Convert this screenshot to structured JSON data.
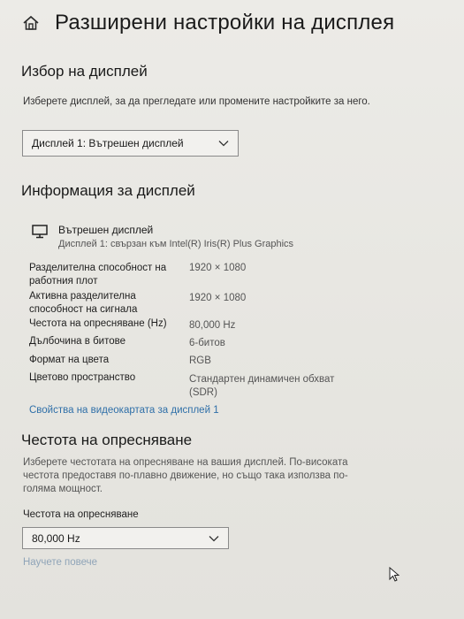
{
  "header": {
    "title": "Разширени настройки на дисплея",
    "home_icon": "home-icon"
  },
  "display_select": {
    "title": "Избор на дисплей",
    "description": "Изберете дисплей, за да прегледате или промените настройките за него.",
    "selected": "Дисплей 1: Вътрешен дисплей"
  },
  "display_info": {
    "title": "Информация за дисплей",
    "monitor_icon": "monitor-icon",
    "name": "Вътрешен дисплей",
    "connection": "Дисплей 1: свързан към Intel(R) Iris(R) Plus Graphics",
    "rows": [
      {
        "label": "Разделителна способност на работния плот",
        "value": "1920 × 1080"
      },
      {
        "label": "Активна разделителна способност на сигнала",
        "value": "1920 × 1080"
      },
      {
        "label": "Честота на опресняване (Hz)",
        "value": "80,000 Hz"
      },
      {
        "label": "Дълбочина в битове",
        "value": "6-битов"
      },
      {
        "label": "Формат на цвета",
        "value": "RGB"
      },
      {
        "label": "Цветово пространство",
        "value": "Стандартен динамичен обхват (SDR)"
      }
    ],
    "adapter_link": "Свойства на видеокартата за дисплей 1"
  },
  "refresh": {
    "title": "Честота на опресняване",
    "description": "Изберете честотата на опресняване на вашия дисплей. По-високата честота предоставя по-плавно движение, но също така използва по-голяма мощност.",
    "dropdown_label": "Честота на опресняване",
    "selected": "80,000 Hz",
    "learn_more": "Научете повече"
  }
}
